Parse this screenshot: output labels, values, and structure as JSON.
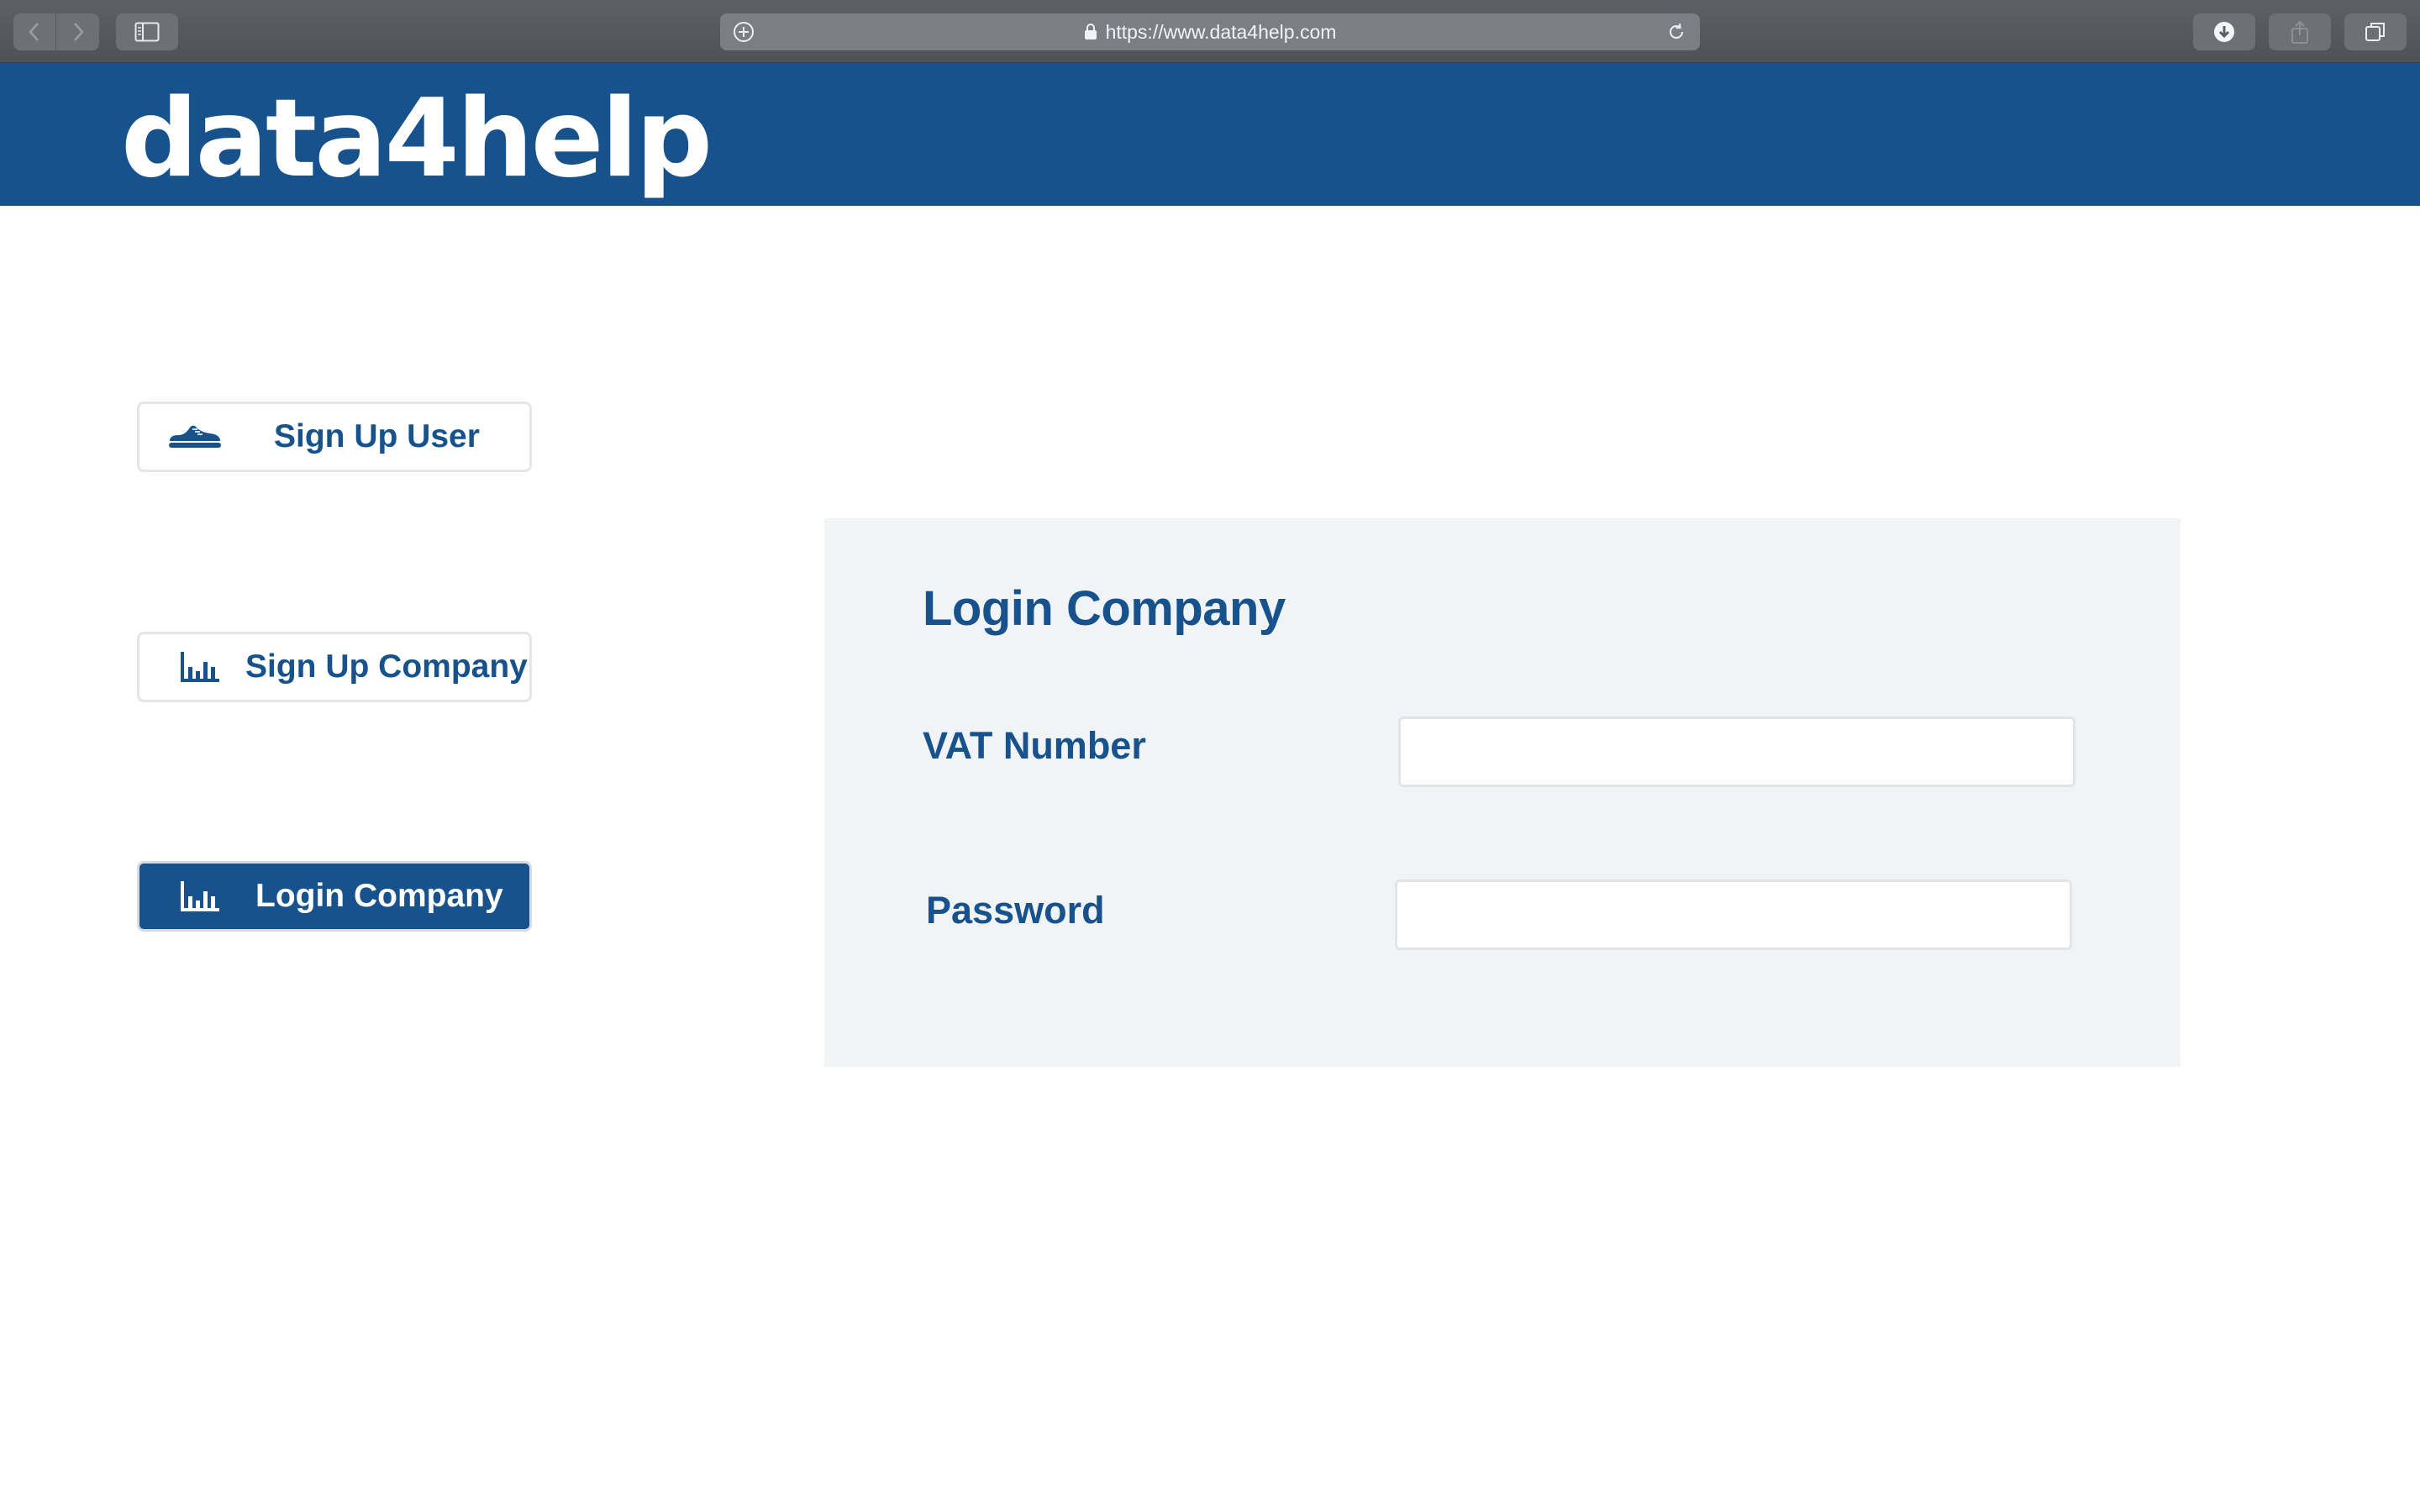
{
  "browser": {
    "url": "https://www.data4help.com",
    "icons": {
      "back": "chevron-left-icon",
      "forward": "chevron-right-icon",
      "sidebar": "sidebar-icon",
      "add": "plus-circle-icon",
      "lock": "lock-icon",
      "reload": "reload-icon",
      "download": "download-icon",
      "share": "share-icon",
      "tabs": "tabs-icon"
    }
  },
  "header": {
    "logo": "data4help",
    "color": "#17528c"
  },
  "menu": {
    "items": [
      {
        "label": "Sign Up User",
        "icon": "shoe-icon",
        "active": false
      },
      {
        "label": "Sign Up Company",
        "icon": "bar-chart-icon",
        "active": false
      },
      {
        "label": "Login Company",
        "icon": "bar-chart-icon",
        "active": true
      }
    ]
  },
  "form": {
    "title": "Login Company",
    "vat_label": "VAT Number",
    "vat_value": "",
    "password_label": "Password",
    "password_value": ""
  },
  "colors": {
    "accent": "#17528c",
    "panel_bg": "#f1f4f7"
  }
}
